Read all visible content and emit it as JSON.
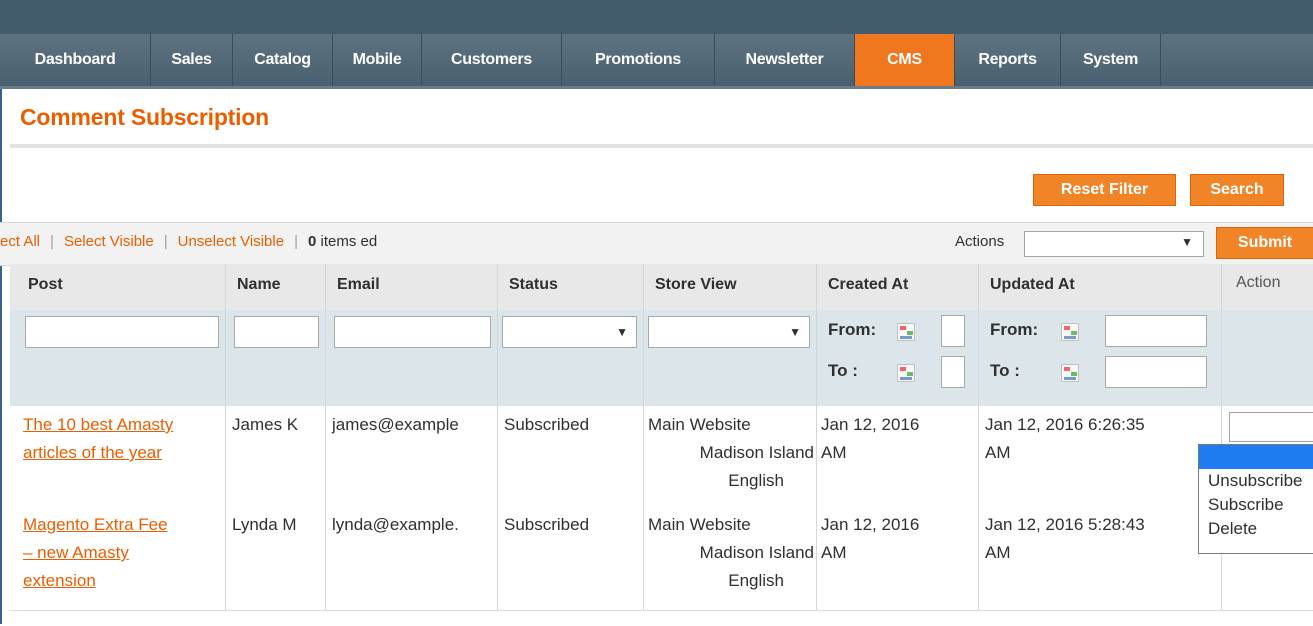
{
  "nav": {
    "items": [
      {
        "label": "Dashboard"
      },
      {
        "label": "Sales"
      },
      {
        "label": "Catalog"
      },
      {
        "label": "Mobile"
      },
      {
        "label": "Customers"
      },
      {
        "label": "Promotions"
      },
      {
        "label": "Newsletter"
      },
      {
        "label": "CMS"
      },
      {
        "label": "Reports"
      },
      {
        "label": "System"
      }
    ],
    "active": "CMS"
  },
  "page": {
    "title": "Comment Subscription"
  },
  "buttons": {
    "reset_filter": "Reset Filter",
    "search": "Search",
    "submit": "Submit"
  },
  "massaction": {
    "select_all": "ect All",
    "select_visible": "Select Visible",
    "unselect_visible": "Unselect Visible",
    "count": "0",
    "count_suffix": " items ed",
    "actions_label": "Actions",
    "actions_value": ""
  },
  "grid": {
    "columns": [
      "Post",
      "Name",
      "Email",
      "Status",
      "Store View",
      "Created At",
      "Updated At",
      "Action"
    ],
    "filter": {
      "from_label": "From:",
      "to_label": "To :"
    },
    "rows": [
      {
        "post_line1": "The 10 best Amasty",
        "post_line2": "articles of the year",
        "post_line3": "",
        "name": "James K",
        "email": "james@example",
        "status": "Subscribed",
        "store_line1": "Main Website",
        "store_line2": "Madison Island",
        "store_line3": "English",
        "created_line1": "Jan 12, 2016",
        "created_line2": "AM",
        "updated_line1": "Jan 12, 2016 6:26:35",
        "updated_line2": "AM"
      },
      {
        "post_line1": "Magento Extra Fee",
        "post_line2": "– new Amasty",
        "post_line3": "extension",
        "name": "Lynda M",
        "email": "lynda@example.",
        "status": "Subscribed",
        "store_line1": "Main Website",
        "store_line2": "Madison Island",
        "store_line3": "English",
        "created_line1": "Jan 12, 2016",
        "created_line2": "AM",
        "updated_line1": "Jan 12, 2016 5:28:43",
        "updated_line2": "AM"
      }
    ]
  },
  "row_action_dropdown": {
    "options": [
      "",
      "Unsubscribe",
      "Subscribe",
      "Delete"
    ],
    "highlighted_index": 0
  },
  "colors": {
    "accent": "#eb5e00",
    "nav_bg": "#4f6878",
    "nav_active": "#f0771d",
    "highlight": "#1e7cf0"
  }
}
